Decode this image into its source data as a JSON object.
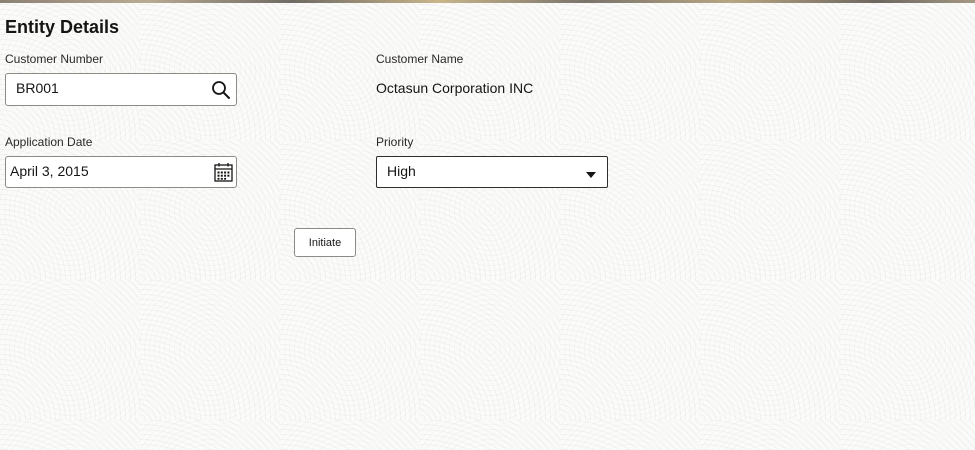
{
  "section": {
    "title": "Entity Details"
  },
  "customer_number": {
    "label": "Customer Number",
    "value": "BR001",
    "icon": "search-icon"
  },
  "customer_name": {
    "label": "Customer Name",
    "value": "Octasun Corporation INC"
  },
  "application_date": {
    "label": "Application Date",
    "value": "April 3, 2015",
    "icon": "calendar-icon"
  },
  "priority": {
    "label": "Priority",
    "selected": "High",
    "icon": "caret-down-icon"
  },
  "actions": {
    "initiate_label": "Initiate"
  },
  "colors": {
    "text": "#161513",
    "border": "#8e8a86",
    "select_border": "#312d2a",
    "background": "#fbfbfa"
  }
}
